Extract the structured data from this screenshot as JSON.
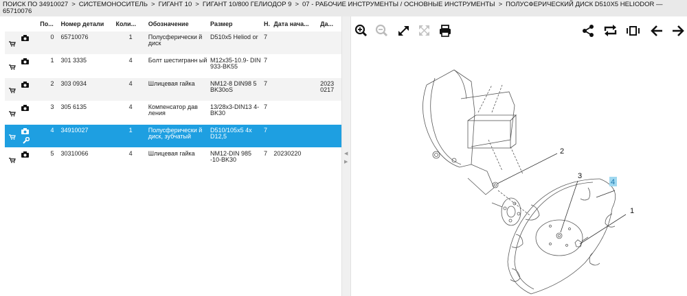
{
  "breadcrumb": {
    "items": [
      "ПОИСК ПО 34910027",
      "СИСТЕМОНОСИТЕЛЬ",
      "ГИГАНТ 10",
      "ГИГАНТ 10/800 ГЕЛИОДОР 9",
      "07 - РАБОЧИЕ ИНСТРУМЕНТЫ / ОСНОВНЫЕ ИНСТРУМЕНТЫ",
      "ПОЛУСФЕРИЧЕСКИЙ ДИСК D510X5 HELIODOR —"
    ],
    "line2": "65710076",
    "separator": ">"
  },
  "table": {
    "headers": {
      "pos": "По...",
      "number": "Номер детали",
      "qty": "Коли...",
      "desc": "Обозначение",
      "size": "Размер",
      "n": "Н.",
      "date": "Дата нача...",
      "da": "Да..."
    },
    "rows": [
      {
        "pos": "0",
        "number": "65710076",
        "qty": "1",
        "desc": "Полусферически й диск",
        "size": "D510x5 Heliod or",
        "n": "7",
        "date": "",
        "da": "",
        "selected": false,
        "wrench": false
      },
      {
        "pos": "1",
        "number": "301 3335",
        "qty": "4",
        "desc": "Болт шестигранн ый",
        "size": "M12x35-10.9- DIN 933-BK55",
        "n": "7",
        "date": "",
        "da": "",
        "selected": false,
        "wrench": false
      },
      {
        "pos": "2",
        "number": "303 0934",
        "qty": "4",
        "desc": "Шлицевая гайка",
        "size": "NM12-8 DIN98 5 BK30oS",
        "n": "7",
        "date": "",
        "da": "2023 0217",
        "selected": false,
        "wrench": false
      },
      {
        "pos": "3",
        "number": "305 6135",
        "qty": "4",
        "desc": "Компенсатор дав ления",
        "size": "13/28x3-DIN13 4-BK30",
        "n": "7",
        "date": "",
        "da": "",
        "selected": false,
        "wrench": false
      },
      {
        "pos": "4",
        "number": "34910027",
        "qty": "1",
        "desc": "Полусферически й диск, зубчатый",
        "size": "D510/105x5 4x D12,5",
        "n": "7",
        "date": "",
        "da": "",
        "selected": true,
        "wrench": true
      },
      {
        "pos": "5",
        "number": "30310066",
        "qty": "4",
        "desc": "Шлицевая гайка",
        "size": "NM12-DIN 985 -10-BK30",
        "n": "7",
        "date": "20230220",
        "da": "",
        "selected": false,
        "wrench": false
      }
    ]
  },
  "toolbar": {
    "left": [
      "zoom-in-icon",
      "zoom-out-icon",
      "expand-icon",
      "fit-icon",
      "print-icon"
    ],
    "right": [
      "share-icon",
      "repeat-icon",
      "fit-width-icon",
      "arrow-left-icon",
      "arrow-right-icon"
    ]
  },
  "diagram": {
    "callouts": [
      "2",
      "3",
      "4",
      "1"
    ],
    "highlighted_callout": "4"
  },
  "colors": {
    "selected_row": "#1e9fe1",
    "highlight_callout": "#9fd8f0",
    "breadcrumb_bg": "#e9e9e9"
  }
}
